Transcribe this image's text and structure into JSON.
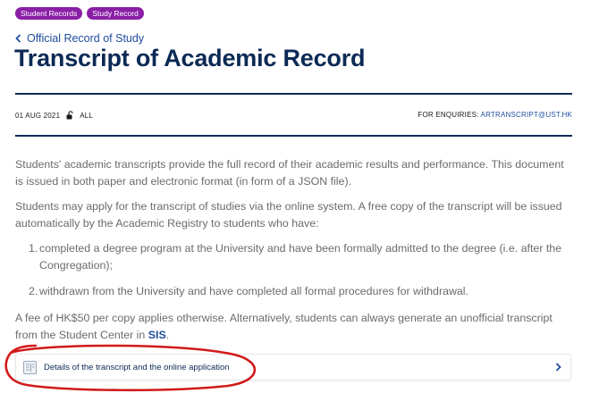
{
  "tags": [
    "Student Records",
    "Study Record"
  ],
  "back_link": "Official Record of Study",
  "title": "Transcript of Academic Record",
  "meta": {
    "date": "01 AUG 2021",
    "audience": "ALL",
    "enquiry_label": "FOR ENQUIRIES: ",
    "enquiry_email": "ARTRANSCRIPT@UST.HK"
  },
  "paragraphs": {
    "intro": "Students' academic transcripts provide the full record of their academic results and performance. This document is issued in both paper and electronic format (in form of a JSON file).",
    "apply": "Students may apply for the transcript of studies via the online system. A free copy of the transcript will be issued automatically by the Academic Registry to students who have:",
    "fee_before": "A fee of HK$50 per copy applies otherwise.  Alternatively, students can always generate an unofficial transcript from the Student Center in ",
    "fee_link": "SIS",
    "fee_after": "."
  },
  "list": [
    {
      "num": "1.",
      "text": "completed a degree program at the University and have been formally admitted to the degree (i.e. after the Congregation);"
    },
    {
      "num": "2.",
      "text": "withdrawn from the University and have completed all formal procedures for withdrawal."
    }
  ],
  "card": {
    "label": "Details of the transcript and the online application",
    "icon": "document-icon",
    "chevron": "chevron-right-icon"
  },
  "colors": {
    "tag": "#8a1fa6",
    "navy": "#0c2a55",
    "link": "#1f4d9e",
    "body_text": "#6b6b6b",
    "annotation": "#d11a1a"
  },
  "icons": {
    "back": "chevron-left-icon",
    "lock": "unlock-icon"
  }
}
